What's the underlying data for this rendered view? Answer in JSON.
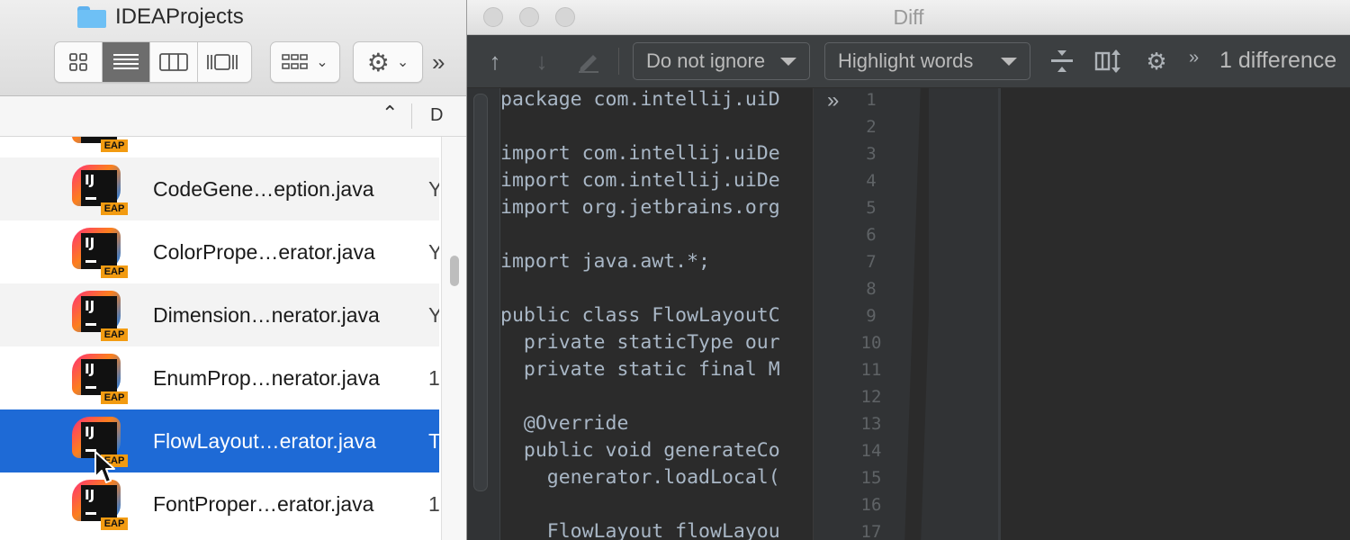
{
  "finder": {
    "title": "IDEAProjects",
    "more_icon": "»",
    "sort_caret": "⌃",
    "column_date_header": "D",
    "rows": [
      {
        "name": "",
        "kind": ""
      },
      {
        "name": "CodeGene…eption.java",
        "kind": "Y"
      },
      {
        "name": "ColorPrope…erator.java",
        "kind": "Y"
      },
      {
        "name": "Dimension…nerator.java",
        "kind": "Y"
      },
      {
        "name": "EnumProp…nerator.java",
        "kind": "1"
      },
      {
        "name": "FlowLayout…erator.java",
        "kind": "T"
      },
      {
        "name": "FontProper…erator.java",
        "kind": "1"
      }
    ],
    "selected_row_index": 5,
    "icon_badge": "EAP",
    "icon_text": "IJ"
  },
  "diff": {
    "title": "Diff",
    "ignore_option": "Do not ignore",
    "highlight_option": "Highlight words",
    "differences": "1 difference",
    "more_icon": "»",
    "expand_right_icon": "»",
    "expand_left_icon": "«",
    "code_lines": [
      "package com.intellij.uiD",
      "",
      "import com.intellij.uiDe",
      "import com.intellij.uiDe",
      "import org.jetbrains.org",
      "",
      "import java.awt.*;",
      "",
      "public class FlowLayoutC",
      "  private staticType our",
      "  private static final M",
      "",
      "  @Override",
      "  public void generateCo",
      "    generator.loadLocal(",
      "",
      "    FlowLayout flowLayou"
    ],
    "line_numbers": [
      "1",
      "2",
      "3",
      "4",
      "5",
      "6",
      "7",
      "8",
      "9",
      "10",
      "11",
      "12",
      "13",
      "14",
      "15",
      "16",
      "17"
    ]
  },
  "colors": {
    "selection": "#1e6ad6",
    "ide_background": "#2b2b2b",
    "ide_toolbar": "#3c3f41",
    "code_text": "#a9b7c6"
  }
}
